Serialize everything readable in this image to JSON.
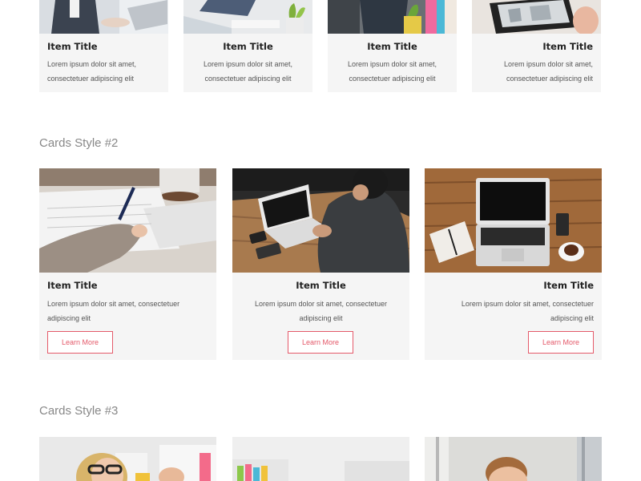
{
  "style1": {
    "cards": [
      {
        "title": "Item Title",
        "text": "Lorem ipsum dolor sit amet, consectetuer adipiscing elit",
        "photo_icon": "laptop-desk-photo"
      },
      {
        "title": "Item Title",
        "text": "Lorem ipsum dolor sit amet, consectetuer adipiscing elit",
        "photo_icon": "plant-desk-photo"
      },
      {
        "title": "Item Title",
        "text": "Lorem ipsum dolor sit amet, consectetuer adipiscing elit",
        "photo_icon": "person-desk-photo"
      },
      {
        "title": "Item Title",
        "text": "Lorem ipsum dolor sit amet, consectetuer adipiscing elit",
        "photo_icon": "tablet-photo"
      }
    ]
  },
  "style2": {
    "heading": "Cards Style #2",
    "cards": [
      {
        "title": "Item Title",
        "text": "Lorem ipsum dolor sit amet, consectetuer adipiscing elit",
        "button": "Learn More",
        "photo_icon": "writing-hand-photo"
      },
      {
        "title": "Item Title",
        "text": "Lorem ipsum dolor sit amet, consectetuer adipiscing elit",
        "button": "Learn More",
        "photo_icon": "man-laptop-photo"
      },
      {
        "title": "Item Title",
        "text": "Lorem ipsum dolor sit amet, consectetuer adipiscing elit",
        "button": "Learn More",
        "photo_icon": "laptop-wood-table-photo"
      }
    ]
  },
  "style3": {
    "heading": "Cards Style #3",
    "cards": [
      {
        "photo_icon": "woman-glasses-photo"
      },
      {
        "photo_icon": "shelf-photo"
      },
      {
        "photo_icon": "man-portrait-photo"
      }
    ]
  },
  "colors": {
    "accent": "#e45a6a",
    "card_bg": "#f5f5f5",
    "heading": "#888888"
  }
}
